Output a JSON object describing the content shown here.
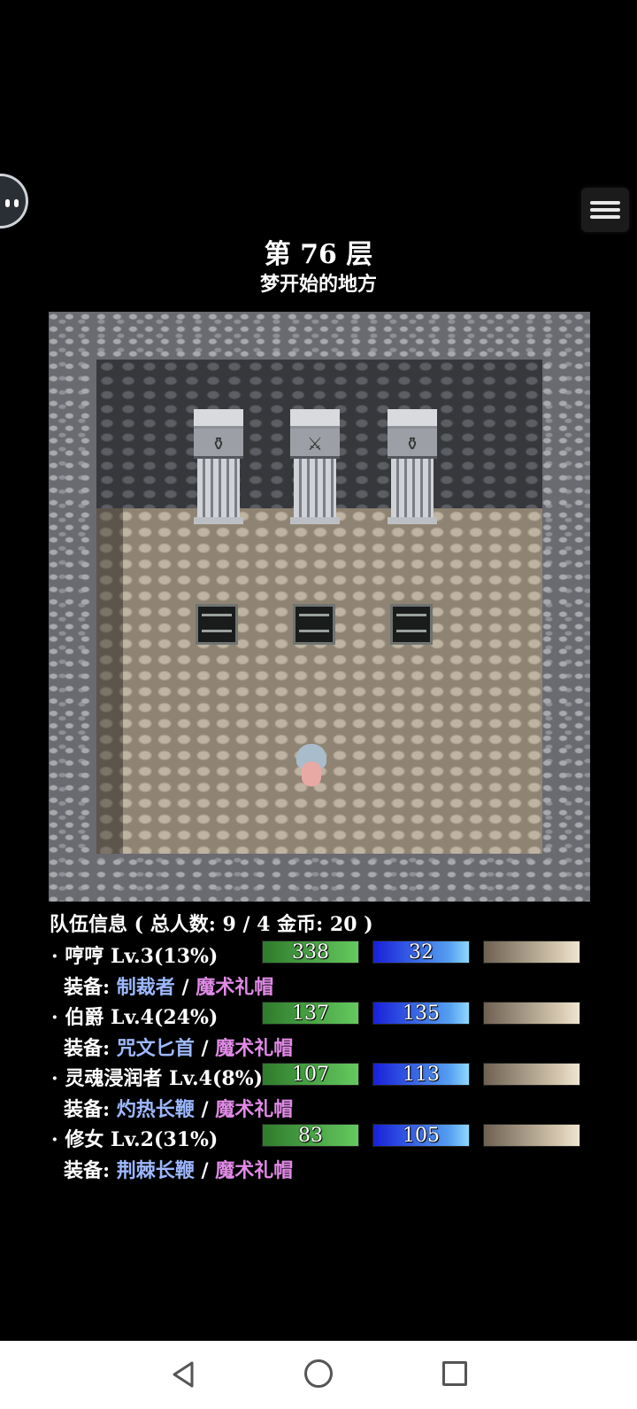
{
  "floor": {
    "title": "第 76 层",
    "subtitle": "梦开始的地方"
  },
  "map": {
    "pillars": [
      {
        "icon": "money-bag-icon",
        "glyph": "⚱"
      },
      {
        "icon": "sword-icon",
        "glyph": "⚔"
      },
      {
        "icon": "money-bag-icon",
        "glyph": "⚱"
      }
    ]
  },
  "party": {
    "header": "队伍信息 ( 总人数: 9 / 4 金币: 20 )",
    "equip_label": "装备:",
    "separator": "/",
    "members": [
      {
        "name": "· 哼哼 Lv.3(13%)",
        "hp": "338",
        "mp": "32",
        "weapon": "制裁者",
        "armor": "魔术礼帽"
      },
      {
        "name": "· 伯爵 Lv.4(24%)",
        "hp": "137",
        "mp": "135",
        "weapon": "咒文匕首",
        "armor": "魔术礼帽"
      },
      {
        "name": "· 灵魂浸润者 Lv.4(8%)",
        "hp": "107",
        "mp": "113",
        "weapon": "灼热长鞭",
        "armor": "魔术礼帽"
      },
      {
        "name": "· 修女 Lv.2(31%)",
        "hp": "83",
        "mp": "105",
        "weapon": "荆棘长鞭",
        "armor": "魔术礼帽"
      }
    ]
  },
  "colors": {
    "hp": "#4fae4a",
    "mp": "#2a50e8",
    "weapon_text": "#9db8ff",
    "armor_text": "#e08ae6"
  }
}
